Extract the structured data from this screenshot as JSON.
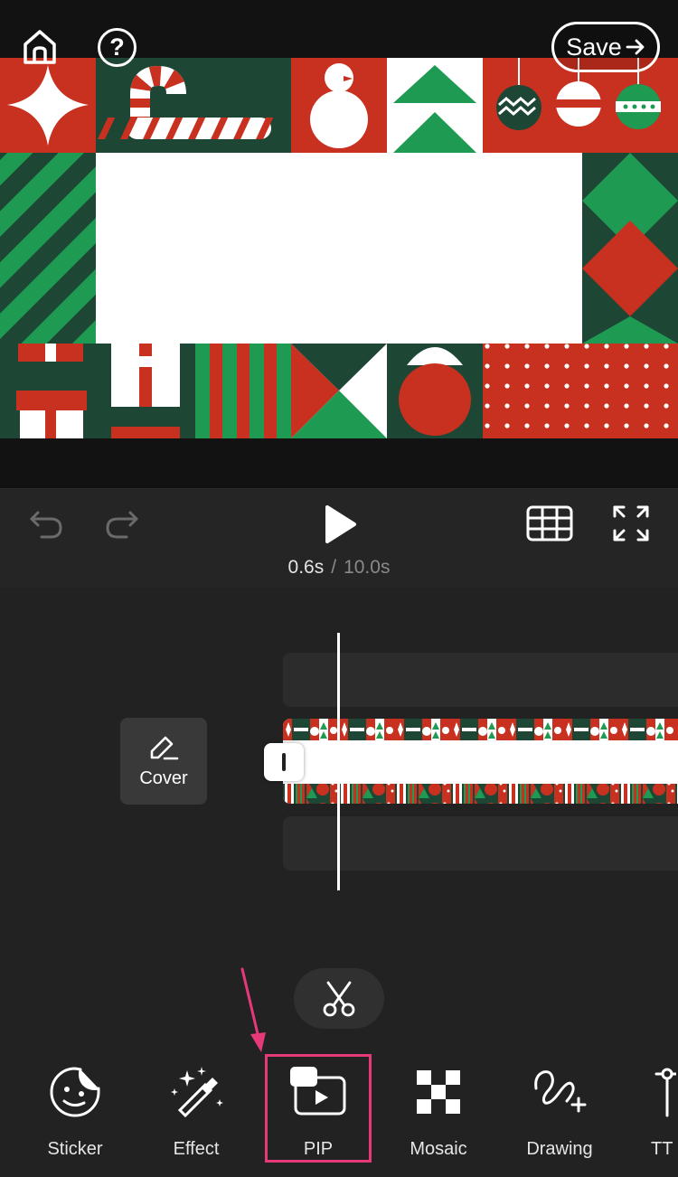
{
  "header": {
    "home_icon": "home-icon",
    "help_glyph": "?",
    "save_label": "Save"
  },
  "playback": {
    "current_time": "0.6s",
    "separator": "/",
    "total_time": "10.0s"
  },
  "timeline": {
    "cover_label": "Cover"
  },
  "toolbar": {
    "items": [
      {
        "label": "Sticker",
        "icon": "sticker-icon"
      },
      {
        "label": "Effect",
        "icon": "effect-wand-icon"
      },
      {
        "label": "PIP",
        "icon": "pip-icon"
      },
      {
        "label": "Mosaic",
        "icon": "mosaic-icon"
      },
      {
        "label": "Drawing",
        "icon": "drawing-icon"
      },
      {
        "label": "TT",
        "icon": "text-icon"
      }
    ],
    "highlighted": "PIP"
  },
  "colors": {
    "holiday_red": "#c8301f",
    "holiday_green": "#1f9a52",
    "holiday_dark_green": "#1d4634",
    "highlight_pink": "#e6397a"
  }
}
